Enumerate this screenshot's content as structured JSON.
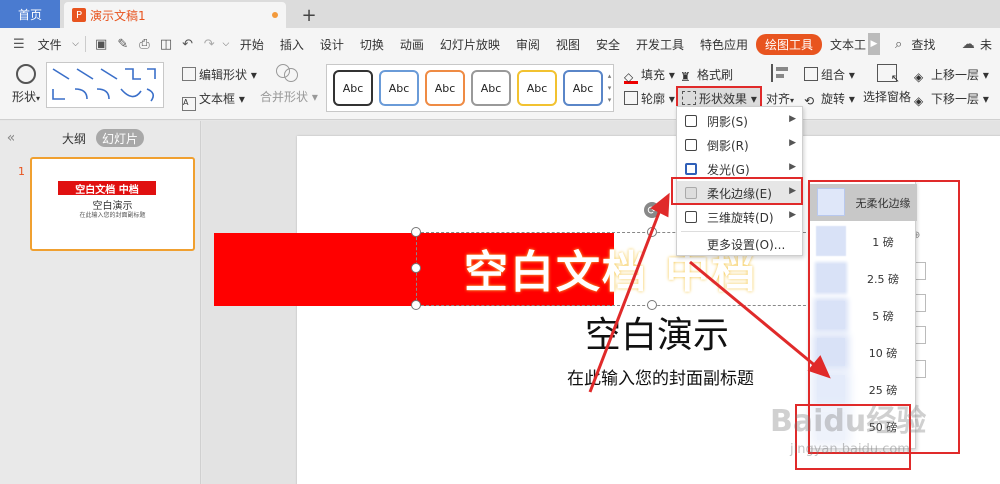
{
  "tabs": {
    "home": "首页",
    "doc": "演示文稿1",
    "doc_icon": "P",
    "add": "+"
  },
  "menubar": {
    "file": "文件",
    "items": [
      "开始",
      "插入",
      "设计",
      "切换",
      "动画",
      "幻灯片放映",
      "审阅",
      "视图",
      "安全",
      "开发工具",
      "特色应用",
      "绘图工具",
      "文本工"
    ],
    "search": "查找",
    "cloud": "未"
  },
  "ribbon": {
    "shape": "形状",
    "edit_shape": "编辑形状",
    "text_box": "文本框",
    "merge_shape": "合并形状",
    "style_sample": "Abc",
    "fill": "填充",
    "format_brush": "格式刷",
    "outline": "轮廓",
    "shape_effect": "形状效果",
    "align": "对齐",
    "group": "组合",
    "rotate": "旋转",
    "select_pane": "选择窗格",
    "bring_forward": "上移一层",
    "send_backward": "下移一层"
  },
  "left_panel": {
    "collapse": "«",
    "tab_outline": "大纲",
    "tab_slides": "幻灯片",
    "slide_number": "1",
    "thumb_title": "空白文档  中档",
    "thumb_subtitle": "空白演示",
    "thumb_caption": "在此输入您的封面副标题"
  },
  "slide": {
    "title": "空白文档  中档",
    "subtitle": "空白演示",
    "caption": "在此输入您的封面副标题"
  },
  "shape_effect_menu": {
    "items": [
      {
        "label": "阴影(S)",
        "has_submenu": true
      },
      {
        "label": "倒影(R)",
        "has_submenu": true
      },
      {
        "label": "发光(G)",
        "has_submenu": true
      },
      {
        "label": "柔化边缘(E)",
        "has_submenu": true
      },
      {
        "label": "三维旋转(D)",
        "has_submenu": true
      },
      {
        "label": "更多设置(O)...",
        "has_submenu": false
      }
    ]
  },
  "soft_edge_menu": {
    "items": [
      "无柔化边缘",
      "1 磅",
      "2.5 磅",
      "5 磅",
      "10 磅",
      "25 磅",
      "50 磅"
    ]
  },
  "watermark": {
    "brand": "Baidu经验",
    "url": "jingyan.baidu.com"
  },
  "colors": {
    "accent": "#e8541f",
    "home_tab": "#4a7bd0",
    "title_fill": "#ff0000",
    "annotation": "#e02a2a"
  }
}
